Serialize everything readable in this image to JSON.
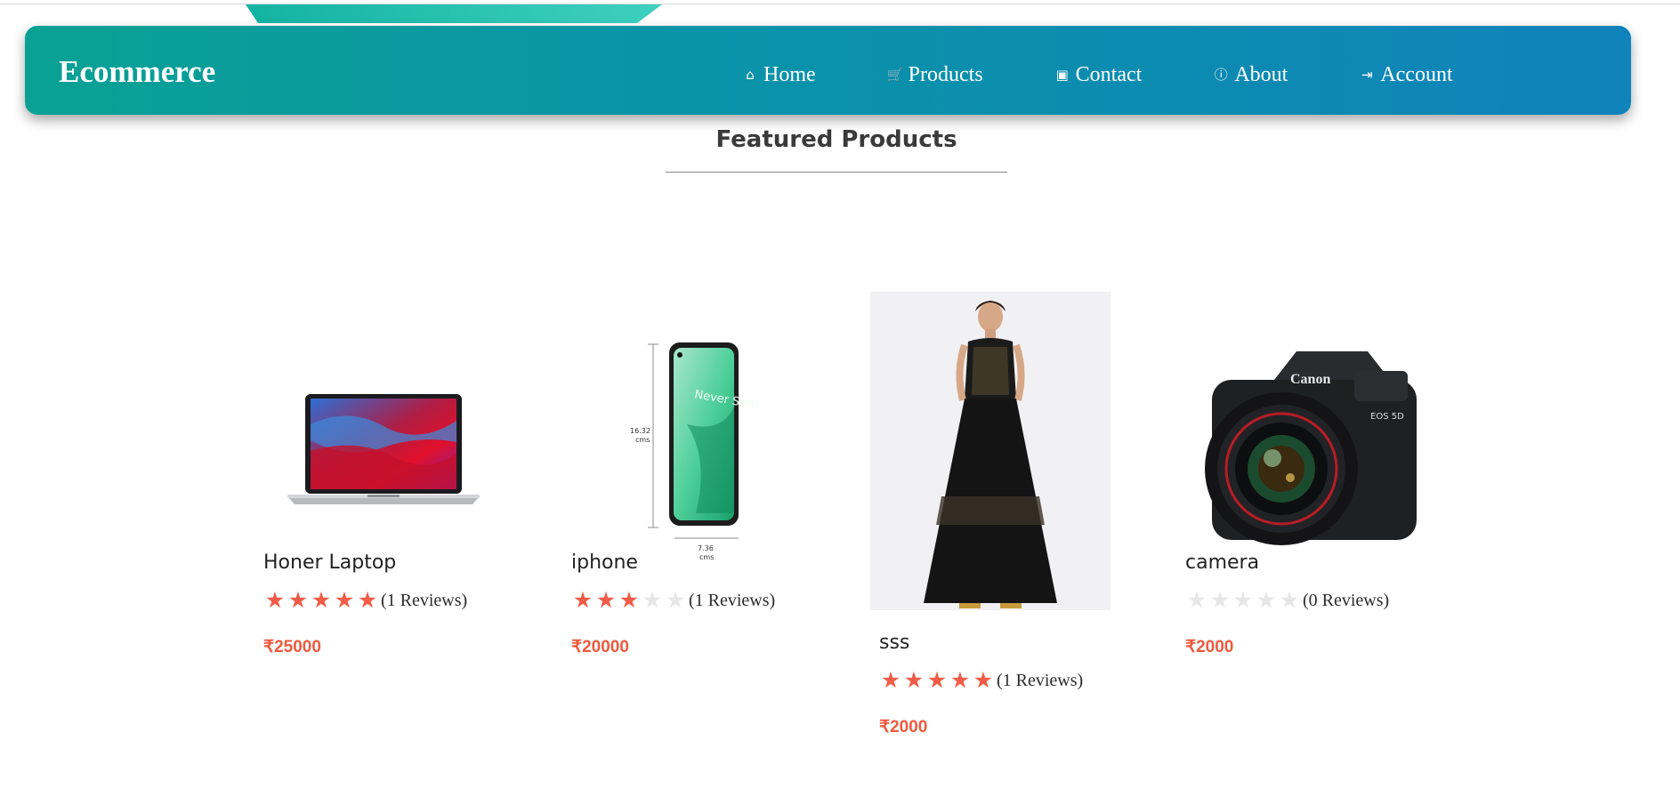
{
  "brand": "Ecommerce",
  "nav": [
    {
      "label": "Home",
      "icon": "home-icon",
      "glyph": "⌂"
    },
    {
      "label": "Products",
      "icon": "cart-icon",
      "glyph": "🛒"
    },
    {
      "label": "Contact",
      "icon": "contact-card-icon",
      "glyph": "▣"
    },
    {
      "label": "About",
      "icon": "info-icon",
      "glyph": "ⓘ"
    },
    {
      "label": "Account",
      "icon": "login-icon",
      "glyph": "⇥"
    }
  ],
  "section_title": "Featured Products",
  "products": [
    {
      "name": "Honer Laptop",
      "rating": 5,
      "reviews": "(1 Reviews)",
      "price": "₹25000",
      "image": "laptop-image"
    },
    {
      "name": "iphone",
      "rating": 3,
      "reviews": "(1 Reviews)",
      "price": "₹20000",
      "image": "phone-image"
    },
    {
      "name": "sss",
      "rating": 5,
      "reviews": "(1 Reviews)",
      "price": "₹2000",
      "image": "dress-image"
    },
    {
      "name": "camera",
      "rating": 0,
      "reviews": "(0 Reviews)",
      "price": "₹2000",
      "image": "camera-image"
    }
  ],
  "phone_dims": {
    "height": "16.32",
    "width": "7.36",
    "unit": "cms",
    "screen_text": "Never Settle"
  },
  "camera_brand": "Canon",
  "camera_model": "EOS 5D"
}
